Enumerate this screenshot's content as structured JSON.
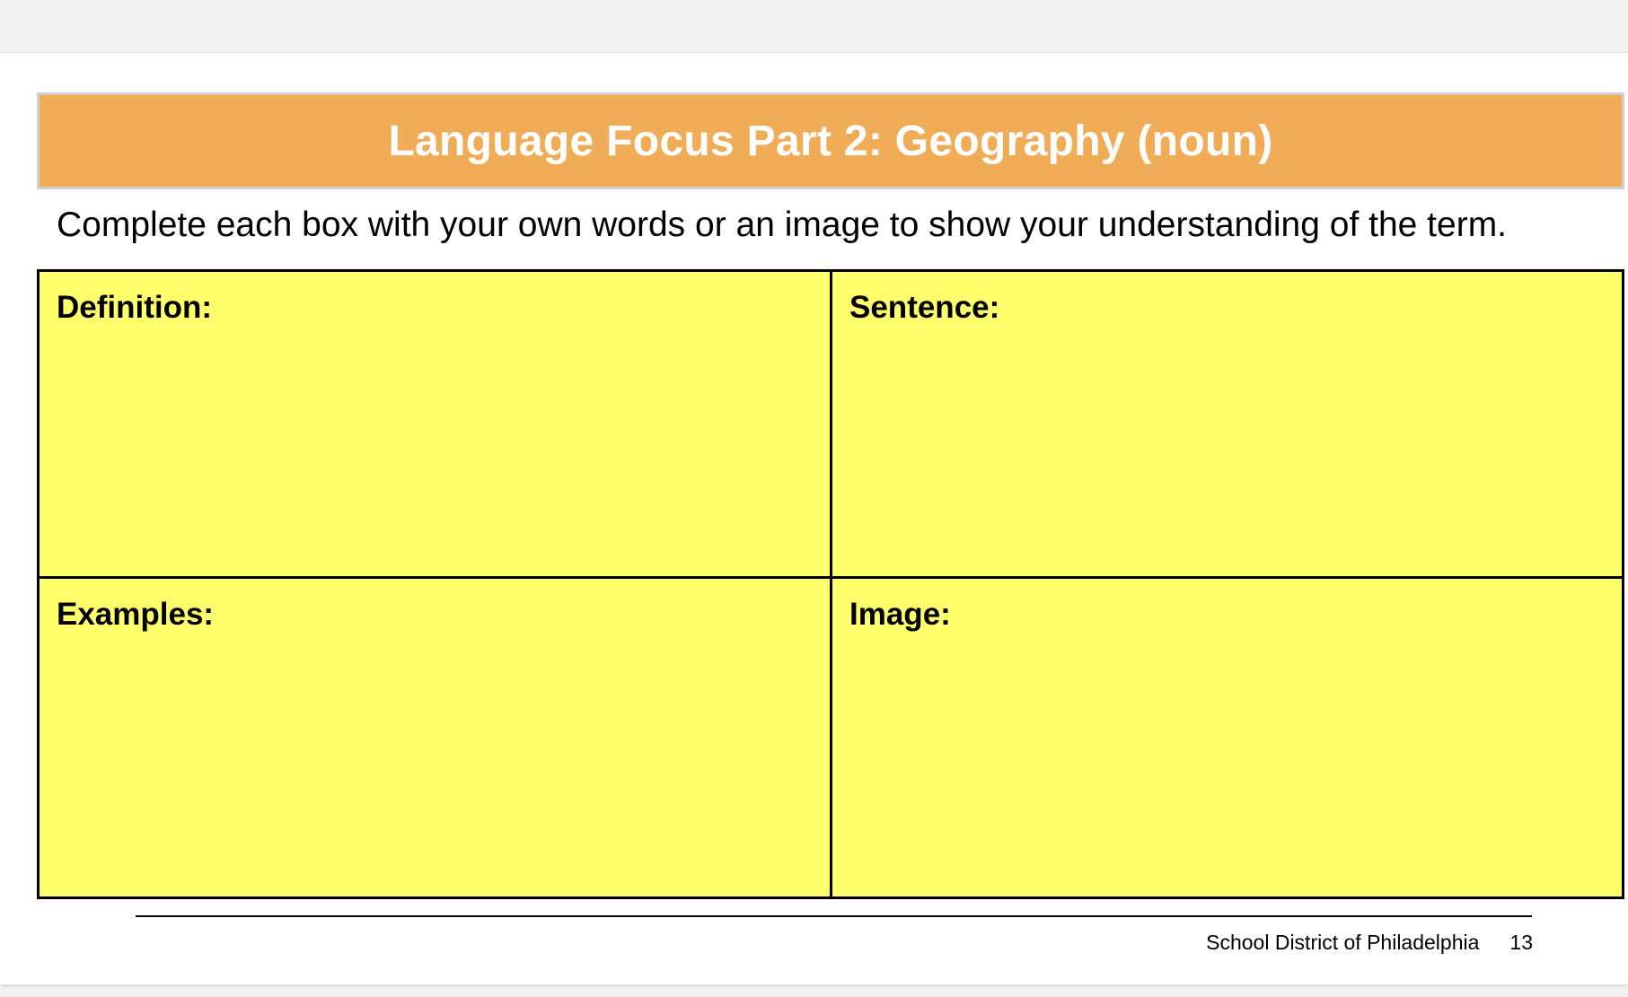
{
  "header": {
    "title": "Language Focus Part 2: Geography (noun)"
  },
  "instructions": "Complete each box with your own words or an image to show your understanding of the term.",
  "boxes": {
    "definition_label": "Definition:",
    "sentence_label": "Sentence:",
    "examples_label": "Examples:",
    "image_label": "Image:"
  },
  "footer": {
    "organization": "School District of Philadelphia",
    "page_number": "13"
  },
  "colors": {
    "banner": "#f0ac57",
    "box_fill": "#ffff6b"
  }
}
